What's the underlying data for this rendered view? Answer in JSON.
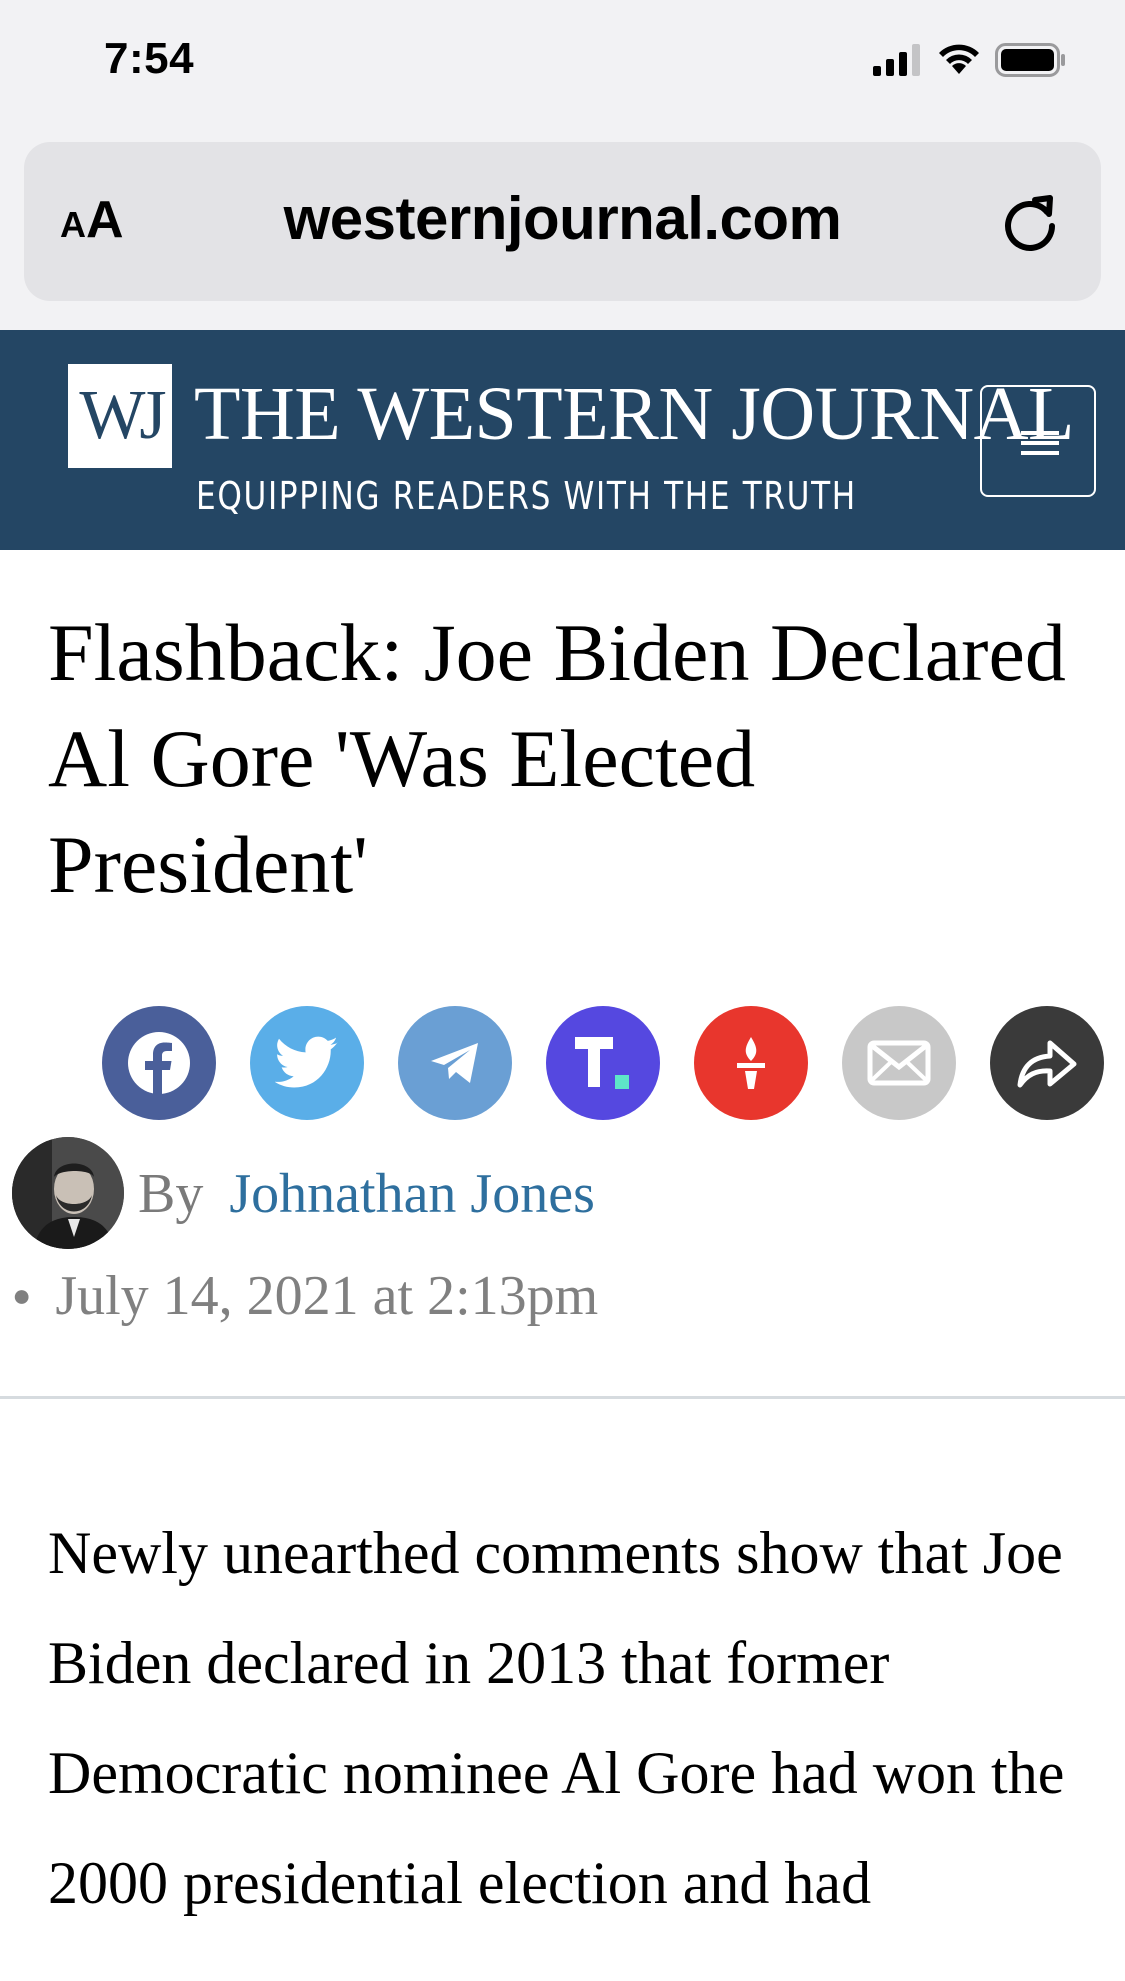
{
  "status_bar": {
    "time": "7:54"
  },
  "browser": {
    "aa_small": "A",
    "aa_big": "A",
    "url": "westernjournal.com"
  },
  "site": {
    "logo": "WJ",
    "title": "THE WESTERN JOURNAL",
    "tagline": "EQUIPPING READERS WITH THE TRUTH",
    "brand_color": "#244664"
  },
  "article": {
    "title": "Flashback: Joe Biden Declared Al Gore 'Was Elected President'",
    "share_buttons": [
      {
        "icon": "facebook-icon",
        "color": "#4a5f9a"
      },
      {
        "icon": "twitter-icon",
        "color": "#5aaee8"
      },
      {
        "icon": "telegram-icon",
        "color": "#6a9fd4"
      },
      {
        "icon": "truth-social-icon",
        "color": "#5548e0"
      },
      {
        "icon": "gettr-icon",
        "color": "#e8362d"
      },
      {
        "icon": "email-icon",
        "color": "#c8c8c8"
      },
      {
        "icon": "share-icon",
        "color": "#3a3a3a"
      }
    ],
    "byline_prefix": "By",
    "author": "Johnathan Jones",
    "date": "July 14, 2021 at 2:13pm",
    "body": "Newly unearthed comments show that Joe Biden declared in 2013 that former Democratic nominee Al Gore had won the 2000 presidential election and had"
  }
}
